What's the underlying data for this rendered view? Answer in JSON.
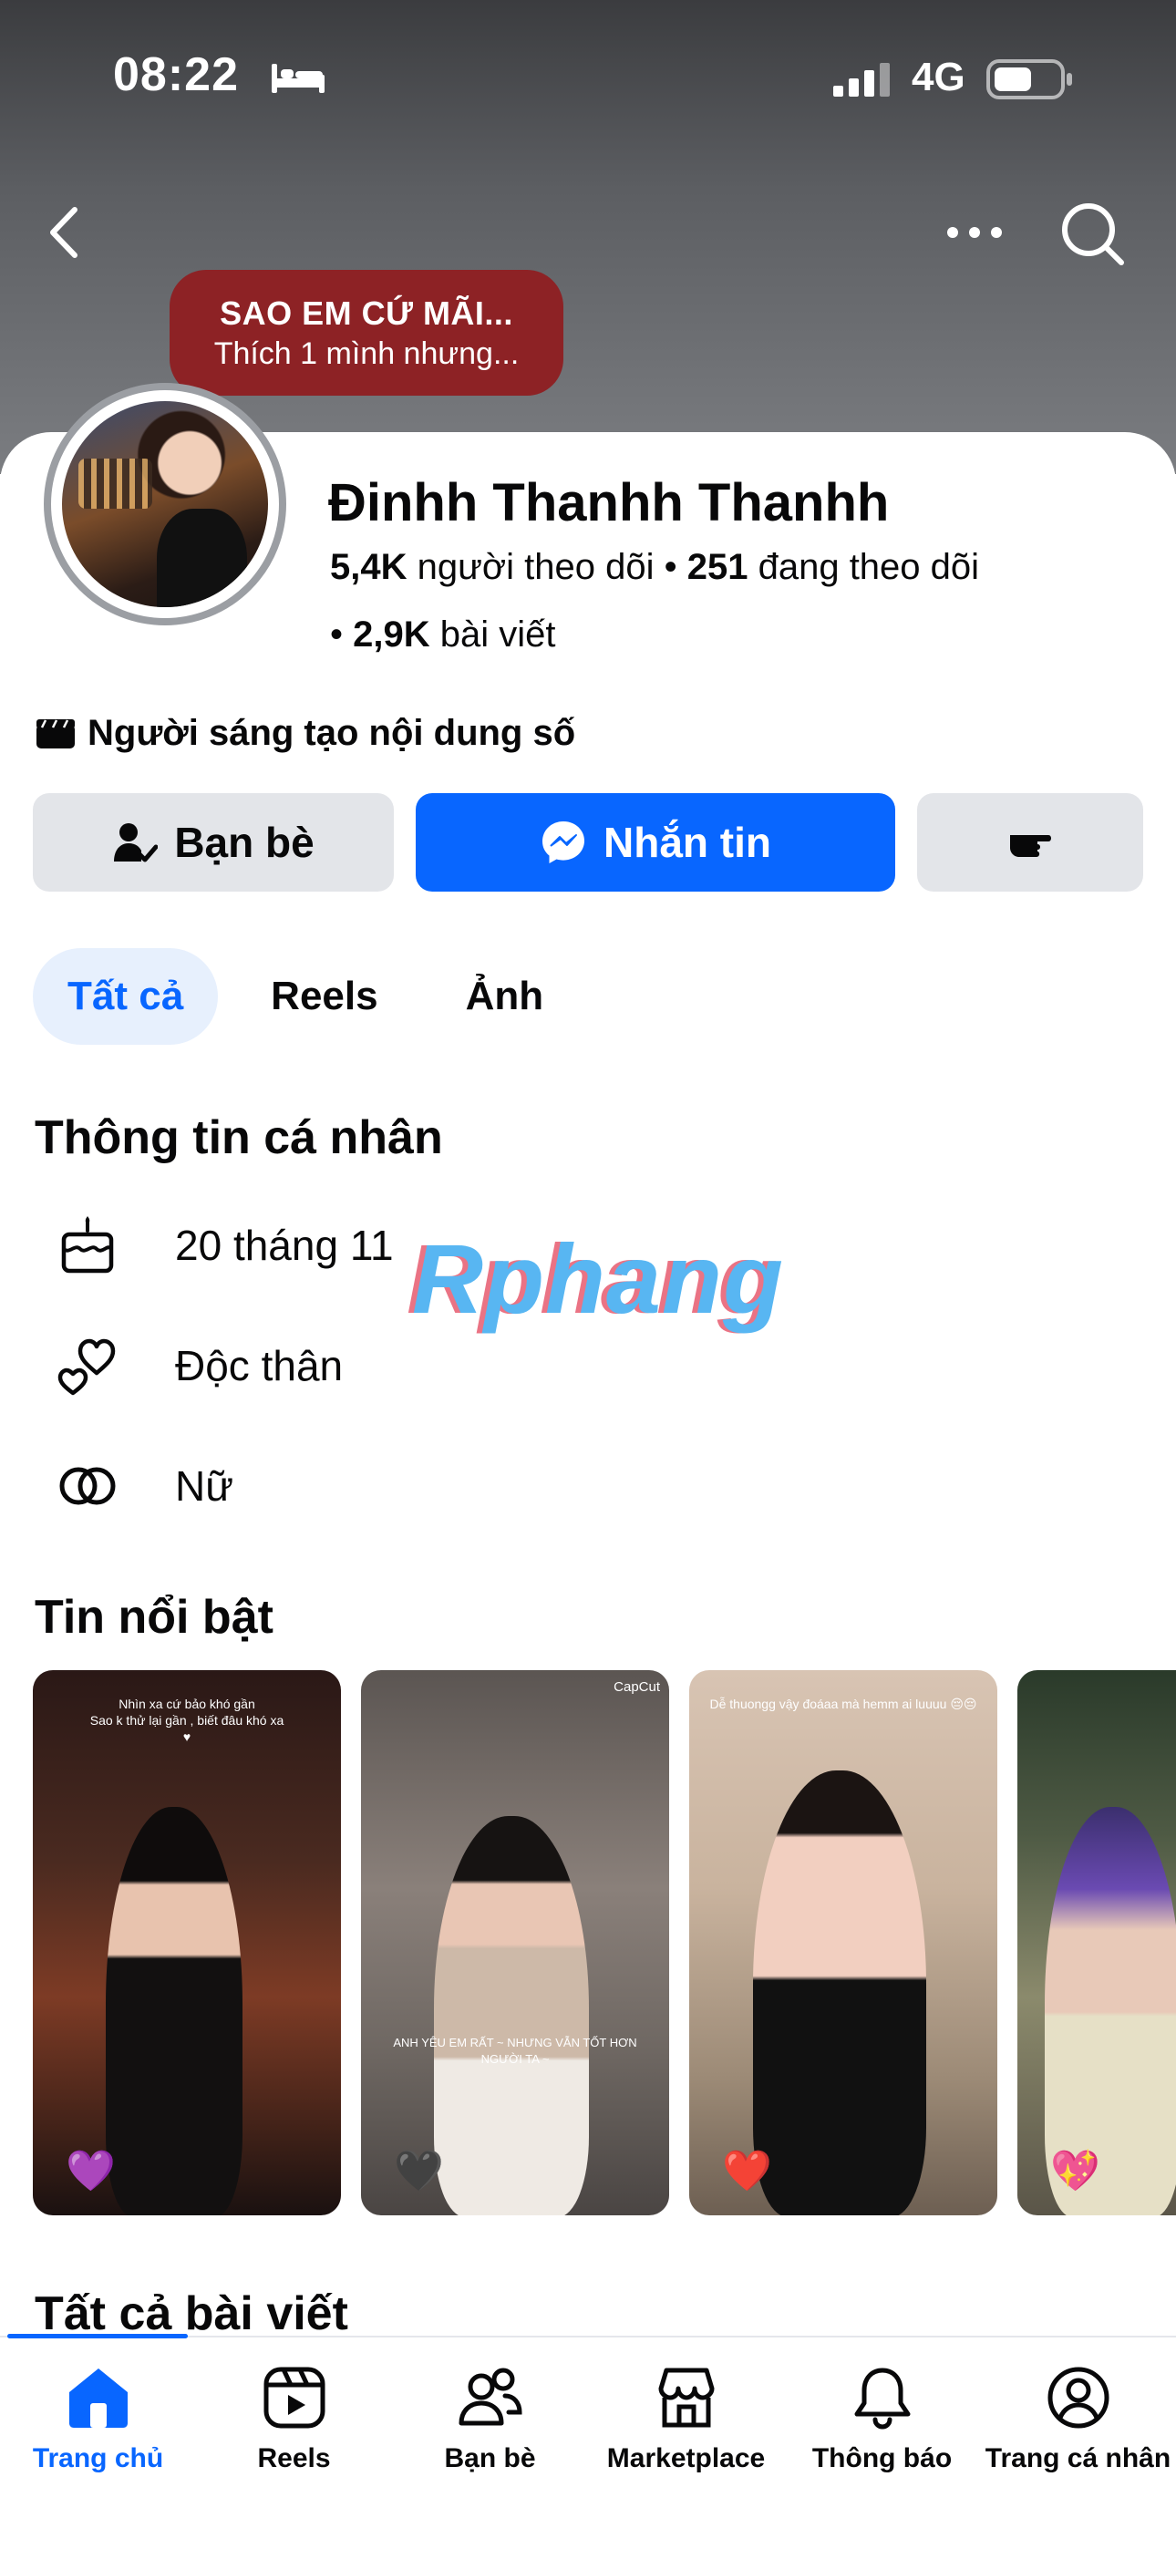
{
  "status_bar": {
    "time": "08:22",
    "network": "4G"
  },
  "cover": {
    "note_line1": "SAO EM CỨ MÃI...",
    "note_line2": "Thích 1 mình nhưng..."
  },
  "profile": {
    "name": "Đinhh Thanhh Thanhh",
    "followers_count": "5,4K",
    "followers_label": "người theo dõi",
    "following_count": "251",
    "following_label": "đang theo dõi",
    "posts_count": "2,9K",
    "posts_label": "bài viết",
    "category": "Người sáng tạo nội dung số"
  },
  "actions": {
    "friends_label": "Bạn bè",
    "message_label": "Nhắn tin"
  },
  "tabs": [
    {
      "label": "Tất cả",
      "active": true
    },
    {
      "label": "Reels",
      "active": false
    },
    {
      "label": "Ảnh",
      "active": false
    }
  ],
  "personal_info": {
    "title": "Thông tin cá nhân",
    "birthday": "20 tháng 11",
    "relationship": "Độc thân",
    "gender": "Nữ"
  },
  "watermark": "Rphang",
  "highlights": {
    "title": "Tin nổi bật",
    "items": [
      {
        "caption": "Nhìn xa cứ bảo khó gần\nSao k thử lại gần , biết đâu khó xa\n♥",
        "emoji": "💜"
      },
      {
        "tag": "CapCut",
        "caption": "ANH YÊU EM RẤT\n~ NHƯNG VẪN TỐT HƠN NGƯỜI TA ~",
        "emoji": "🖤"
      },
      {
        "caption": "Dễ thuongg vậy đoáaa mà\nhemm ai luuuu 😔😔",
        "emoji": "❤️"
      },
      {
        "caption": "",
        "emoji": "💖"
      }
    ]
  },
  "all_posts_title": "Tất cả bài viết",
  "bottom_nav": [
    {
      "label": "Trang chủ",
      "icon": "home-icon",
      "active": true
    },
    {
      "label": "Reels",
      "icon": "reels-icon",
      "active": false
    },
    {
      "label": "Bạn bè",
      "icon": "friends-icon",
      "active": false
    },
    {
      "label": "Marketplace",
      "icon": "marketplace-icon",
      "active": false
    },
    {
      "label": "Thông báo",
      "icon": "bell-icon",
      "active": false
    },
    {
      "label": "Trang cá nhân",
      "icon": "profile-icon",
      "active": false
    }
  ],
  "colors": {
    "accent": "#0866ff",
    "note_bg": "#8d2225",
    "button_gray": "#e3e5e9",
    "tab_active_bg": "#e7f0fd"
  }
}
